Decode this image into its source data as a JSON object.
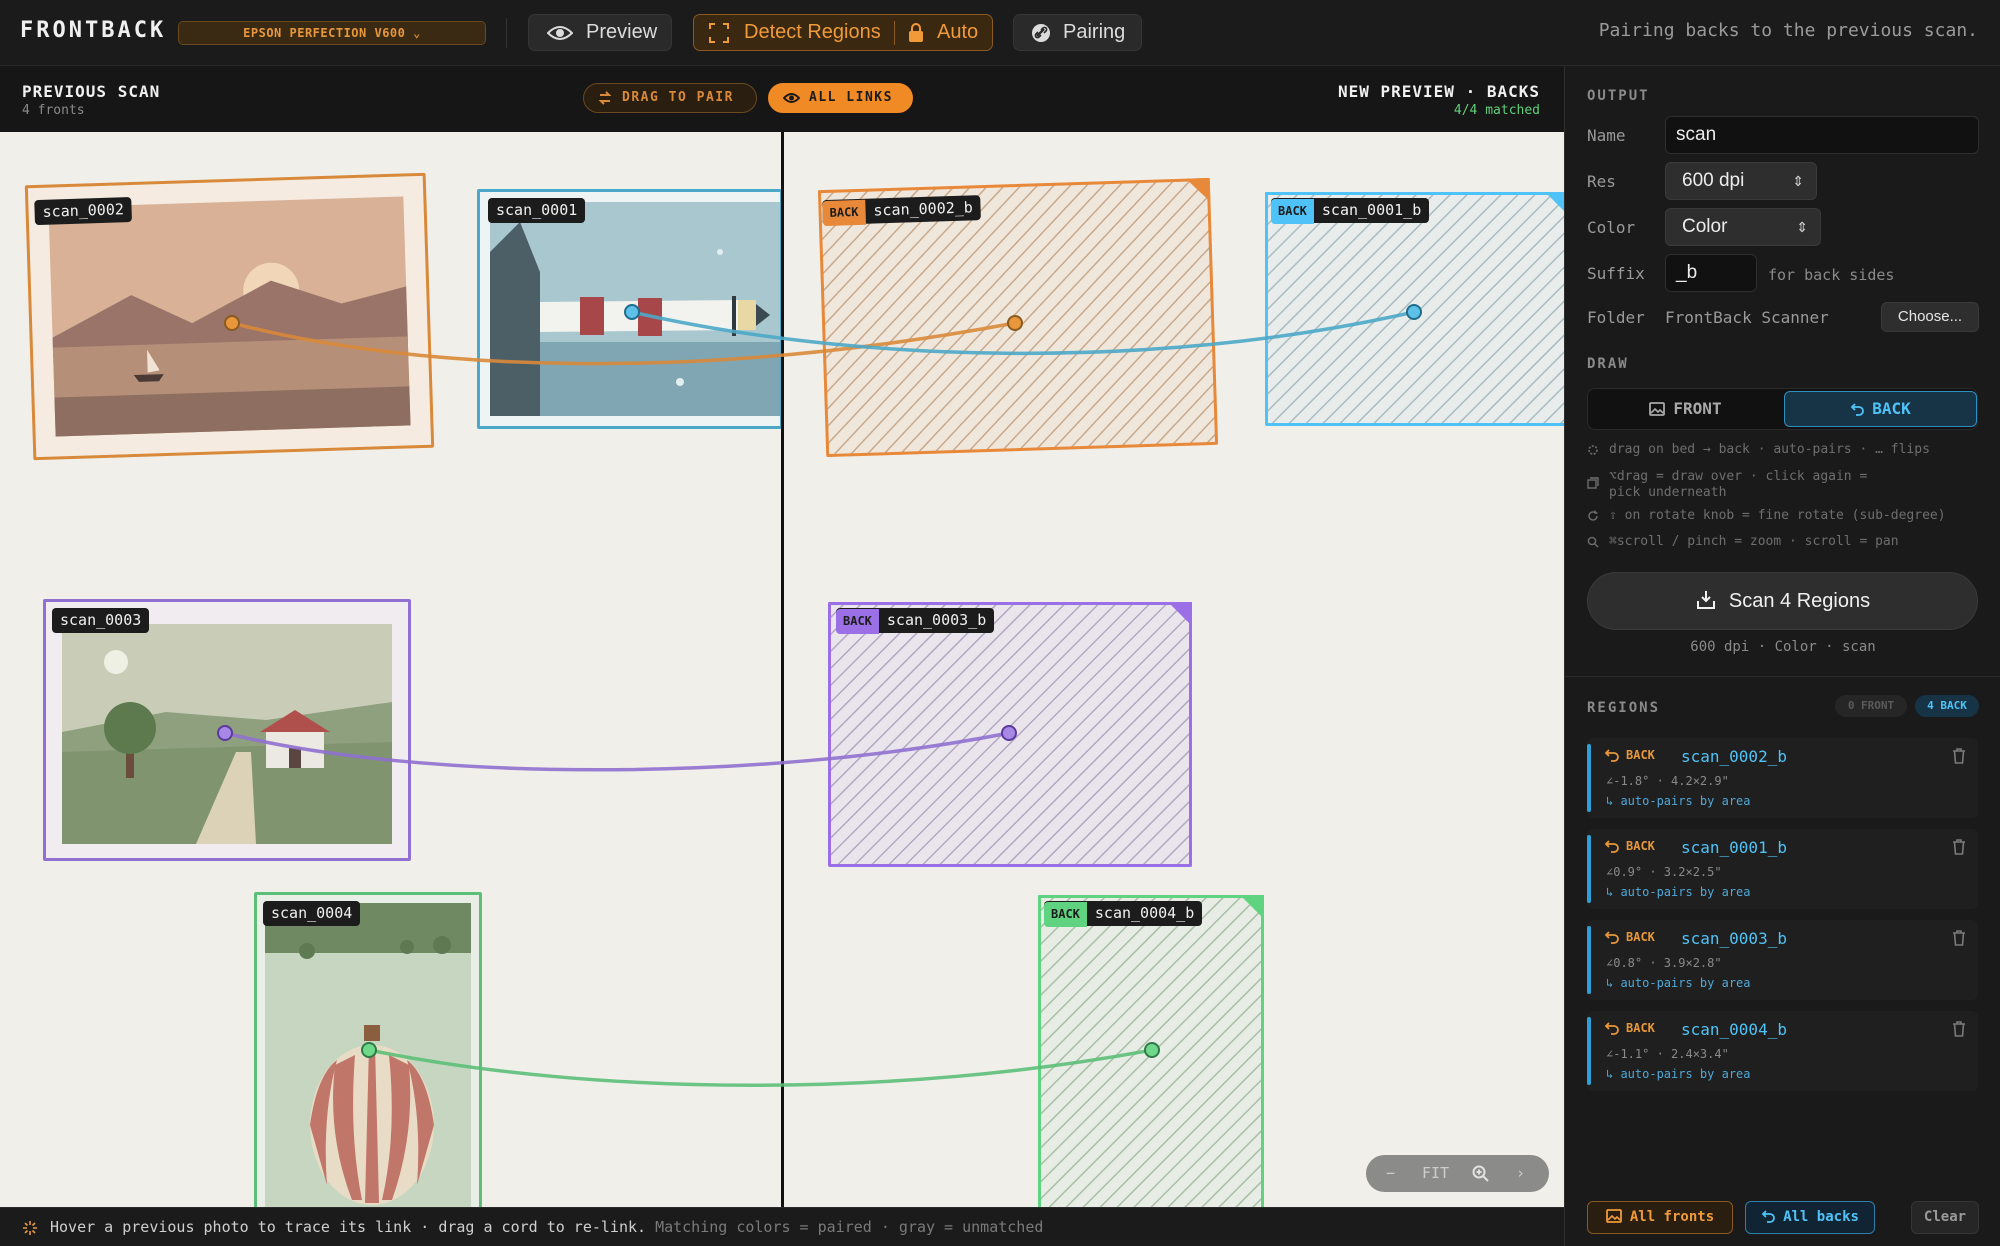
{
  "app": {
    "brand": "FRONTBACK",
    "scanner": "EPSON PERFECTION V600",
    "status": "Pairing backs to the previous scan."
  },
  "toolbar": {
    "preview": "Preview",
    "detect": "Detect Regions",
    "auto": "Auto",
    "pairing": "Pairing"
  },
  "workspace": {
    "left_title": "PREVIOUS SCAN",
    "left_sub": "4 fronts",
    "right_title": "NEW PREVIEW · BACKS",
    "right_sub": "4/4 matched",
    "drag_pill": "DRAG TO PAIR",
    "links_pill": "ALL LINKS"
  },
  "fronts": [
    {
      "name": "scan_0002",
      "color": "#d9893a"
    },
    {
      "name": "scan_0001",
      "color": "#4ba8c8"
    },
    {
      "name": "scan_0003",
      "color": "#9070d0"
    },
    {
      "name": "scan_0004",
      "color": "#5cbf78"
    }
  ],
  "backs": [
    {
      "badge": "BACK",
      "name": "scan_0002_b",
      "color": "#e8893a"
    },
    {
      "badge": "BACK",
      "name": "scan_0001_b",
      "color": "#4fc3f7"
    },
    {
      "badge": "BACK",
      "name": "scan_0003_b",
      "color": "#9b6fe6"
    },
    {
      "badge": "BACK",
      "name": "scan_0004_b",
      "color": "#5fd37f"
    }
  ],
  "zoom": {
    "fit": "FIT"
  },
  "statusbar": {
    "hint": "Hover a previous photo to trace its link · drag a cord to re-link.",
    "legend": "Matching colors = paired · gray = unmatched"
  },
  "sidebar": {
    "output_title": "OUTPUT",
    "name_label": "Name",
    "name_value": "scan",
    "res_label": "Res",
    "res_value": "600 dpi",
    "color_label": "Color",
    "color_value": "Color",
    "suffix_label": "Suffix",
    "suffix_value": "_b",
    "suffix_hint": "for back sides",
    "folder_label": "Folder",
    "folder_value": "FrontBack Scanner",
    "choose": "Choose...",
    "draw_title": "DRAW",
    "front": "FRONT",
    "back": "BACK",
    "hints": [
      "drag on bed → back · auto-pairs · … flips",
      "⌥drag = draw over · click again =",
      "pick underneath",
      "⇧ on rotate knob = fine rotate (sub-degree)",
      "⌘scroll / pinch = zoom · scroll = pan"
    ],
    "scan_button": "Scan 4 Regions",
    "scan_sub": "600 dpi · Color · scan",
    "regions_title": "REGIONS",
    "regions_front": "0 FRONT",
    "regions_back": "4 BACK",
    "regions": [
      {
        "badge": "BACK",
        "name": "scan_0002_b",
        "meta": "∠-1.8° · 4.2×2.9\"",
        "pair": "↳ auto-pairs by area"
      },
      {
        "badge": "BACK",
        "name": "scan_0001_b",
        "meta": "∠0.9° · 3.2×2.5\"",
        "pair": "↳ auto-pairs by area"
      },
      {
        "badge": "BACK",
        "name": "scan_0003_b",
        "meta": "∠0.8° · 3.9×2.8\"",
        "pair": "↳ auto-pairs by area"
      },
      {
        "badge": "BACK",
        "name": "scan_0004_b",
        "meta": "∠-1.1° · 2.4×3.4\"",
        "pair": "↳ auto-pairs by area"
      }
    ],
    "all_fronts": "All fronts",
    "all_backs": "All backs",
    "clear": "Clear"
  }
}
